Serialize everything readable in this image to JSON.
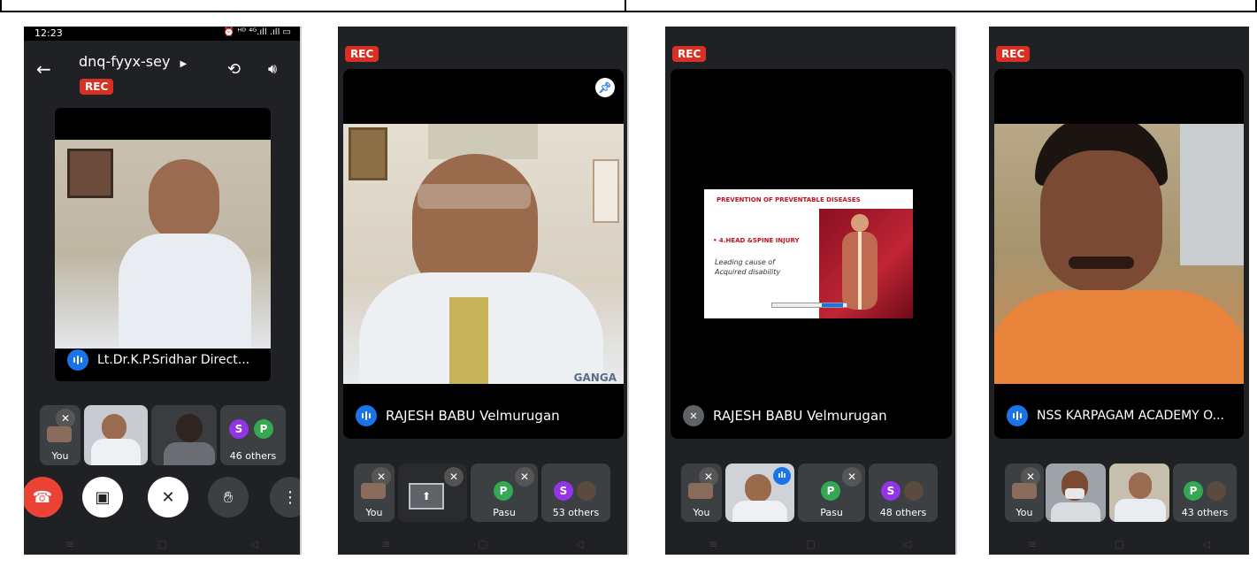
{
  "phone1": {
    "status_time": "12:23",
    "status_icons": "⏰ ᴴᴰ ⁴ᴳ.ıll .ıll ▭",
    "meeting_code": "dnq-fyyx-sey",
    "rec": "REC",
    "speaker_name": "Lt.Dr.K.P.Sridhar Direct...",
    "you_label": "You",
    "avatar_s": "S",
    "avatar_p": "P",
    "others": "46 others"
  },
  "phone2": {
    "rec": "REC",
    "speaker_name": "RAJESH BABU Velmurugan",
    "you_label": "You",
    "avatar_p": "P",
    "pasu_label": "Pasu",
    "avatar_s": "S",
    "others": "53 others",
    "watermark": "GANGA"
  },
  "phone3": {
    "rec": "REC",
    "speaker_name": "RAJESH BABU Velmurugan",
    "slide_title": "PREVENTION OF PREVENTABLE DISEASES",
    "slide_bullet": "• 4.HEAD &SPINE INJURY",
    "slide_text_1": "Leading cause of",
    "slide_text_2": "Acquired disability",
    "you_label": "You",
    "avatar_p": "P",
    "pasu_label": "Pasu",
    "avatar_s": "S",
    "others": "48 others"
  },
  "phone4": {
    "rec": "REC",
    "speaker_name": "NSS KARPAGAM ACADEMY O...",
    "you_label": "You",
    "avatar_p": "P",
    "others": "43 others"
  },
  "colors": {
    "bg": "#202124",
    "tile": "#3c4043",
    "rec": "#d93025",
    "accent": "#1a73e8",
    "end_call": "#ea4335",
    "avatar_purple": "#9334e6",
    "avatar_green": "#34a853"
  }
}
